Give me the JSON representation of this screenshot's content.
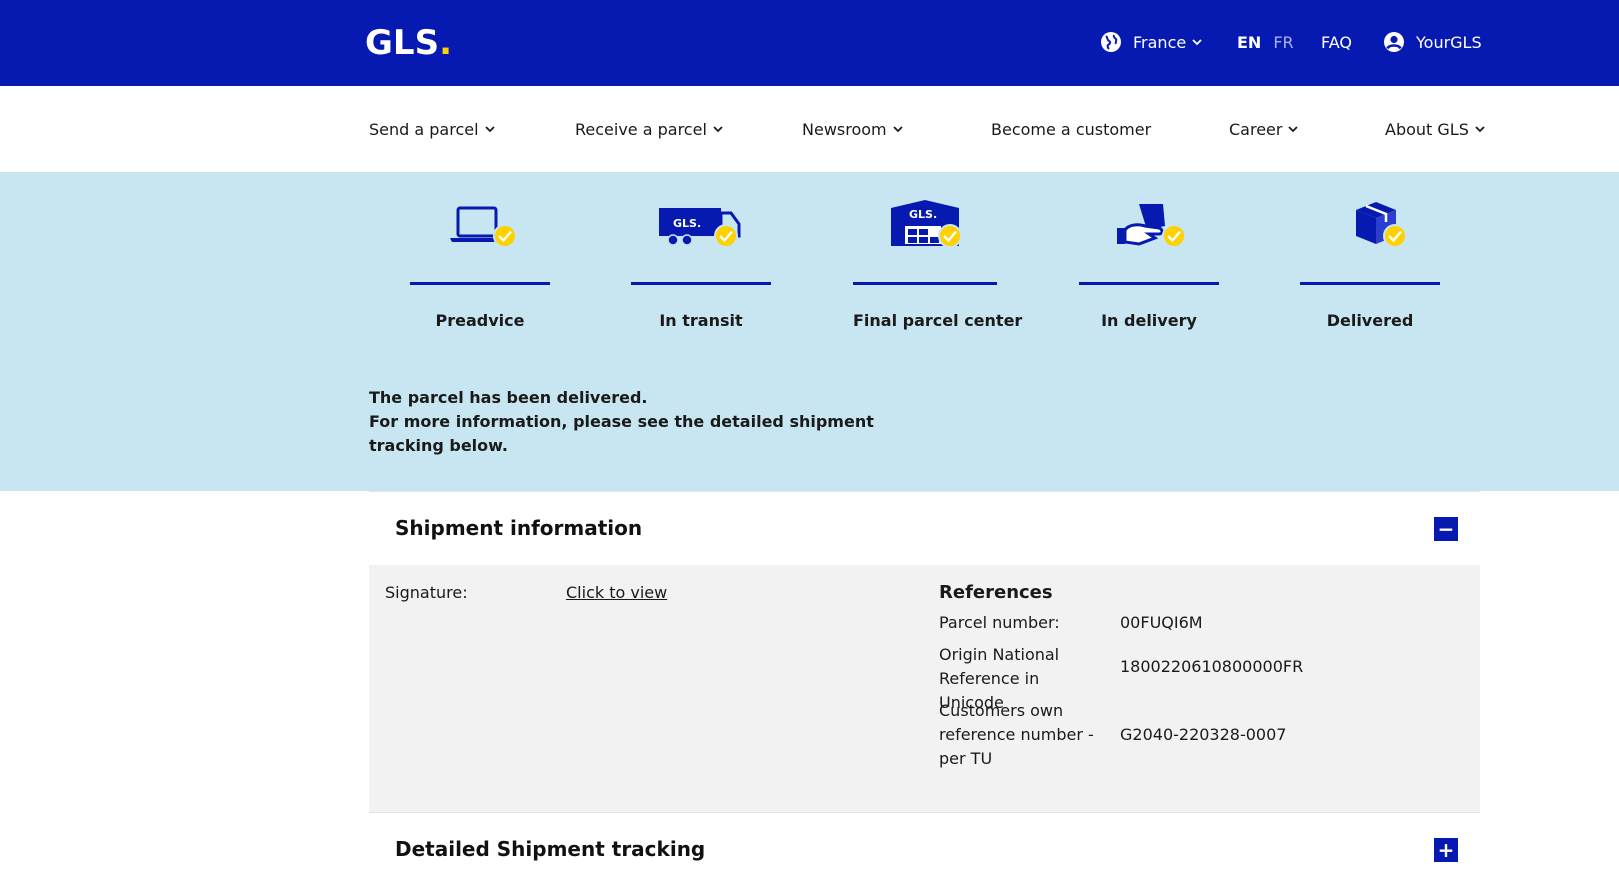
{
  "header": {
    "logo_text": "GLS",
    "logo_dot": ".",
    "country": "France",
    "lang_en": "EN",
    "lang_fr": "FR",
    "faq": "FAQ",
    "account": "YourGLS"
  },
  "nav": {
    "send": "Send a parcel",
    "receive": "Receive a parcel",
    "newsroom": "Newsroom",
    "become": "Become a customer",
    "career": "Career",
    "about": "About GLS"
  },
  "steps": [
    {
      "label": "Preadvice",
      "icon": "laptop-icon"
    },
    {
      "label": "In transit",
      "icon": "truck-icon"
    },
    {
      "label": "Final parcel center",
      "icon": "warehouse-icon"
    },
    {
      "label": "In delivery",
      "icon": "hand-delivery-icon"
    },
    {
      "label": "Delivered",
      "icon": "box-icon"
    }
  ],
  "status": {
    "line1": "The parcel has been delivered.",
    "line2": "For more information, please see the detailed shipment tracking below."
  },
  "shipment": {
    "title": "Shipment information",
    "toggle": "−",
    "signature_label": "Signature:",
    "signature_link": "Click to view",
    "refs_title": "References",
    "parcel_label": "Parcel number:",
    "parcel_value": "00FUQI6M",
    "origin_label": "Origin National Reference in Unicode",
    "origin_value": "1800220610800000FR",
    "customer_label": "Customers own reference number - per TU",
    "customer_value": "G2040-220328-0007"
  },
  "tracking": {
    "title": "Detailed Shipment tracking",
    "toggle": "+"
  },
  "colors": {
    "brand_blue": "#061ab1",
    "brand_yellow": "#ffd100",
    "hero_bg": "#c8e6f2",
    "panel_bg": "#f2f2f2"
  }
}
